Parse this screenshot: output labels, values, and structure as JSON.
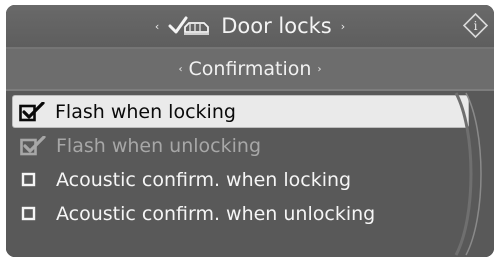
{
  "header": {
    "title": "Door locks",
    "icon": "car-check-icon",
    "left_arrow": "‹",
    "right_arrow": "›",
    "info_label": "i"
  },
  "subheader": {
    "title": "Confirmation",
    "left_arrow": "‹",
    "right_arrow": "›"
  },
  "menu": {
    "items": [
      {
        "label": "Flash when locking",
        "checked": true,
        "selected": true,
        "enabled": true
      },
      {
        "label": "Flash when unlocking",
        "checked": true,
        "selected": false,
        "enabled": false
      },
      {
        "label": "Acoustic confirm. when locking",
        "checked": false,
        "selected": false,
        "enabled": true
      },
      {
        "label": "Acoustic confirm. when unlocking",
        "checked": false,
        "selected": false,
        "enabled": true
      }
    ]
  },
  "colors": {
    "background": "#595959",
    "highlight": "#eaeaea",
    "text": "#f5f5f5",
    "disabled_text": "#a7a7a7"
  }
}
